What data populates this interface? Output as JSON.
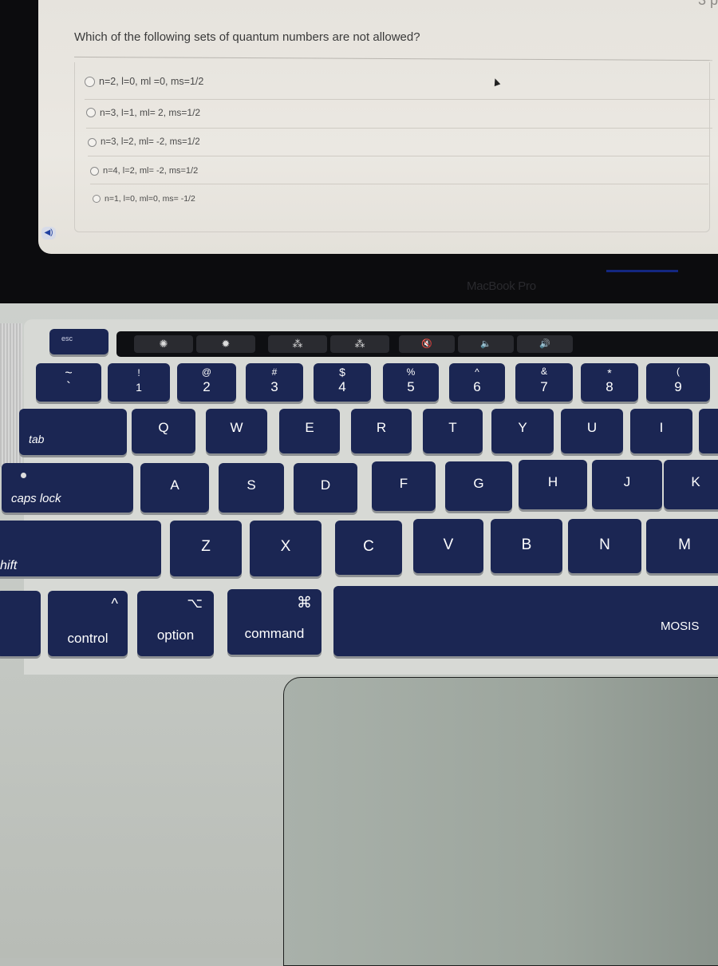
{
  "quiz": {
    "points_label": "3 p",
    "question": "Which of the following sets of quantum numbers are not allowed?",
    "options": [
      {
        "label": "n=2, l=0, ml =0, ms=1/2",
        "selected": false
      },
      {
        "label": "n=3, l=1, ml= 2, ms=1/2",
        "selected": false
      },
      {
        "label": "n=3, l=2, ml= -2, ms=1/2",
        "selected": false
      },
      {
        "label": "n=4, l=2, ml= -2, ms=1/2",
        "selected": false
      },
      {
        "label": "n=1, l=0, ml=0, ms= -1/2",
        "selected": false
      }
    ],
    "audio_icon": "speaker-icon"
  },
  "device": {
    "brand": "MacBook Pro"
  },
  "touchbar": {
    "buttons": [
      {
        "icon": "brightness-down-icon",
        "glyph": "✺"
      },
      {
        "icon": "brightness-up-icon",
        "glyph": "✹"
      },
      {
        "icon": "keyboard-light-down-icon",
        "glyph": "⁂"
      },
      {
        "icon": "keyboard-light-up-icon",
        "glyph": "⁂"
      },
      {
        "icon": "mute-icon",
        "glyph": "🔇"
      },
      {
        "icon": "volume-down-icon",
        "glyph": "🔈"
      },
      {
        "icon": "volume-up-icon",
        "glyph": "🔊"
      }
    ]
  },
  "keyboard": {
    "esc": "esc",
    "number_row": [
      {
        "top": "~",
        "main": "`"
      },
      {
        "top": "!",
        "main": "1"
      },
      {
        "top": "@",
        "main": "2"
      },
      {
        "top": "#",
        "main": "3"
      },
      {
        "top": "$",
        "main": "4"
      },
      {
        "top": "%",
        "main": "5"
      },
      {
        "top": "^",
        "main": "6"
      },
      {
        "top": "&",
        "main": "7"
      },
      {
        "top": "*",
        "main": "8"
      },
      {
        "top": "(",
        "main": "9"
      }
    ],
    "tab": "tab",
    "qwerty_row": [
      "Q",
      "W",
      "E",
      "R",
      "T",
      "Y",
      "U",
      "I"
    ],
    "caps_lock": "caps lock",
    "home_row": [
      "A",
      "S",
      "D",
      "F",
      "G",
      "H",
      "J",
      "K"
    ],
    "shift": "hift",
    "bottom_letter_row": [
      "Z",
      "X",
      "C",
      "V",
      "B",
      "N",
      "M"
    ],
    "control": {
      "symbol": "^",
      "label": "control"
    },
    "option": {
      "symbol": "⌥",
      "label": "option"
    },
    "command": {
      "symbol": "⌘",
      "label": "command"
    },
    "spacebar_brand": "MOSIS"
  }
}
